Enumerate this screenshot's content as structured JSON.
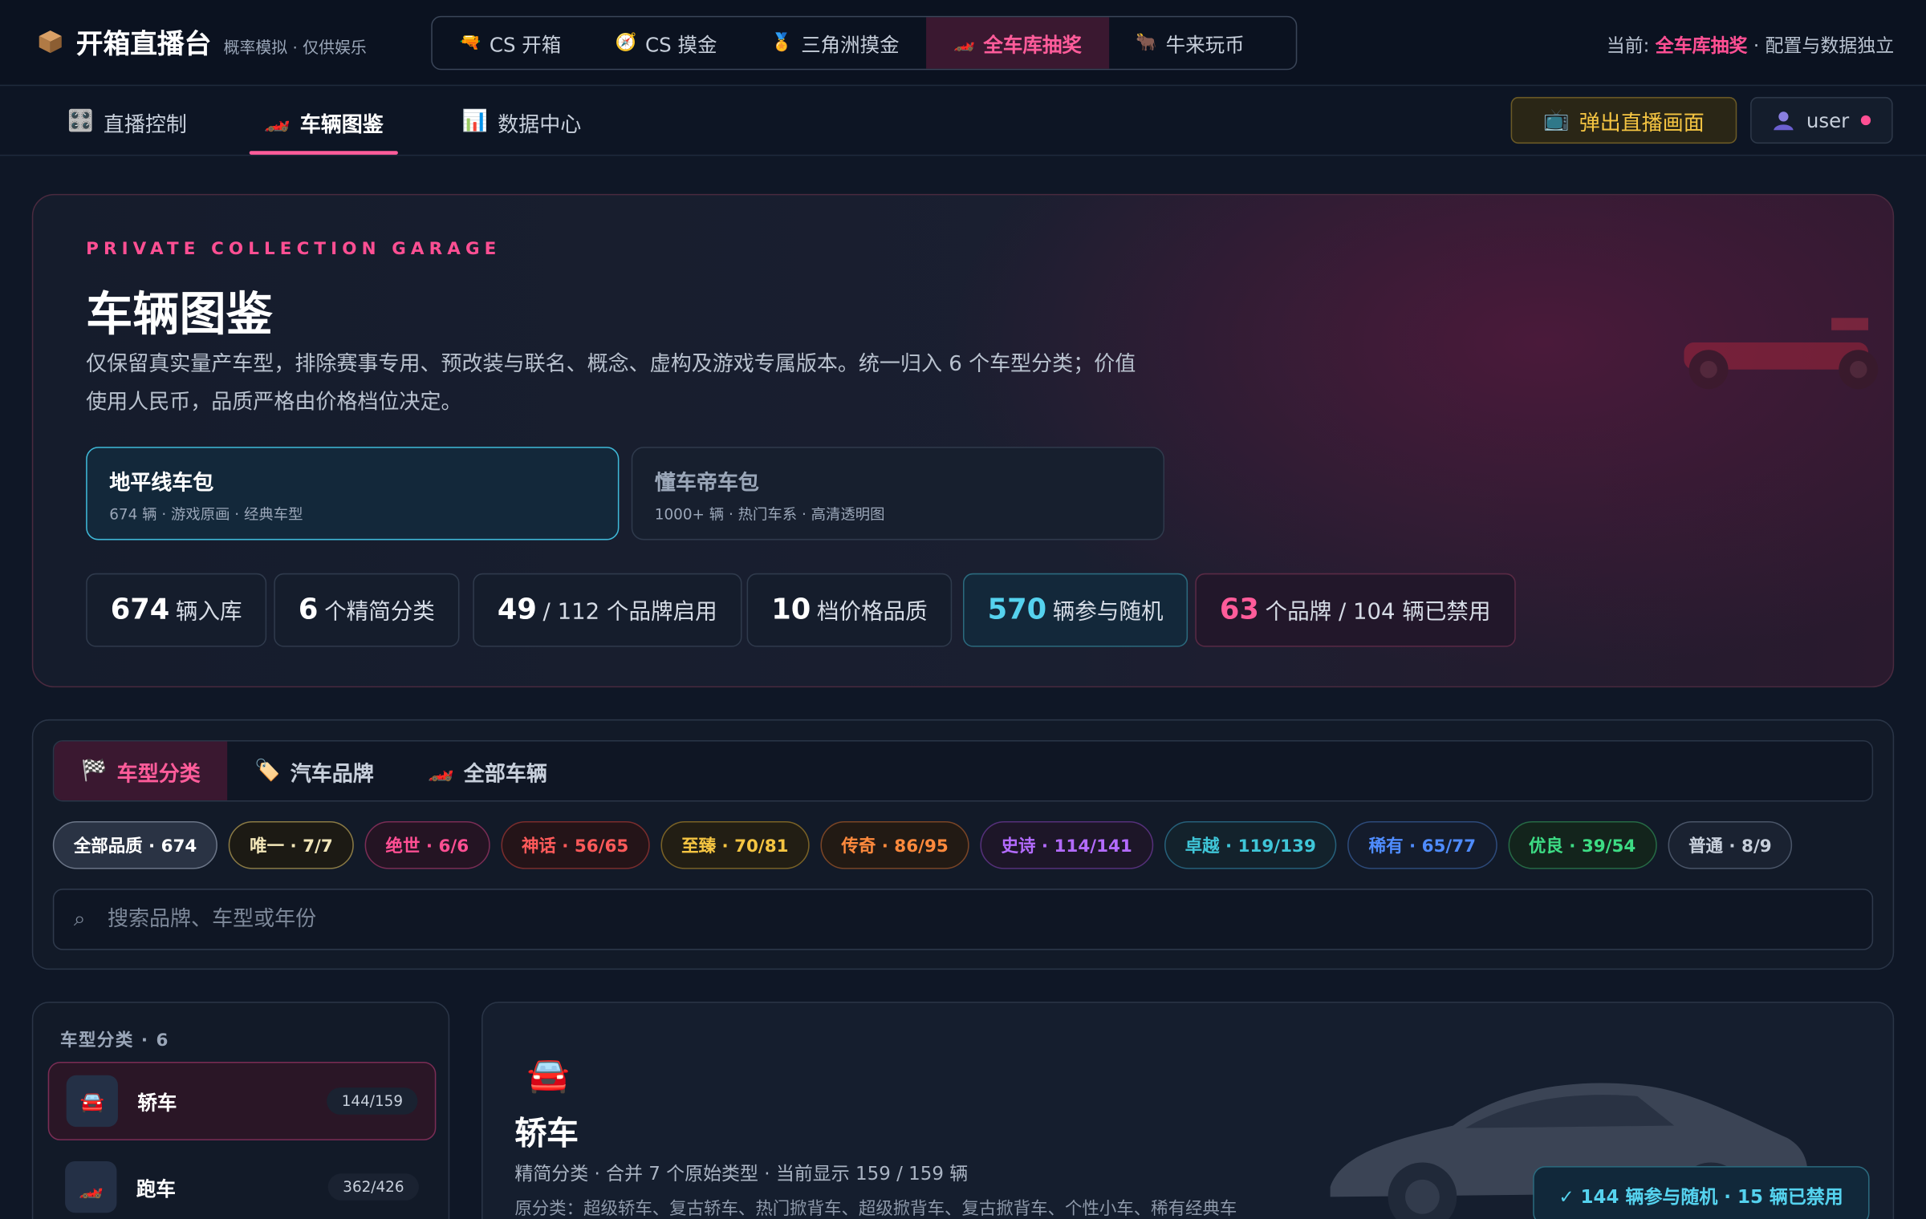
{
  "app": {
    "name": "开箱直播台",
    "subtitle": "概率模拟 · 仅供娱乐",
    "game_tabs": [
      {
        "label": "CS 开箱",
        "icon": "🔫"
      },
      {
        "label": "CS 摸金",
        "icon": "🧭"
      },
      {
        "label": "三角洲摸金",
        "icon": "🏅"
      },
      {
        "label": "全车库抽奖",
        "icon": "🏎️"
      },
      {
        "label": "牛来玩币",
        "icon": "🐂"
      }
    ],
    "active_game_tab": "全车库抽奖",
    "current_prefix": "当前:",
    "current_value": "全车库抽奖",
    "current_suffix": "· 配置与数据独立"
  },
  "subnav": {
    "tabs": [
      {
        "label": "直播控制",
        "icon": "🎛️"
      },
      {
        "label": "车辆图鉴",
        "icon": "🏎️"
      },
      {
        "label": "数据中心",
        "icon": "📊"
      }
    ],
    "active": "车辆图鉴",
    "popout_label": "弹出直播画面",
    "popout_icon": "📺",
    "user_label": "user"
  },
  "hero": {
    "kicker": "PRIVATE COLLECTION GARAGE",
    "title": "车辆图鉴",
    "description": "仅保留真实量产车型，排除赛事专用、预改装与联名、概念、虚构及游戏专属版本。统一归入 6 个车型分类；价值使用人民币，品质严格由价格档位决定。",
    "packs": [
      {
        "title": "地平线车包",
        "sub": "674 辆 · 游戏原画 · 经典车型",
        "selected": true
      },
      {
        "title": "懂车帝车包",
        "sub": "1000+ 辆 · 热门车系 · 高清透明图",
        "selected": false
      }
    ],
    "stats": [
      {
        "num": "674",
        "text": "辆入库"
      },
      {
        "num": "6",
        "text": "个精简分类"
      },
      {
        "num": "49",
        "text": "/ 112 个品牌启用"
      },
      {
        "num": "10",
        "text": "档价格品质"
      },
      {
        "num": "570",
        "text": "辆参与随机"
      },
      {
        "num": "63",
        "text": "个品牌 / 104 辆已禁用"
      }
    ]
  },
  "filter": {
    "tabs": [
      {
        "label": "车型分类",
        "icon": "🏁"
      },
      {
        "label": "汽车品牌",
        "icon": "🏷️"
      },
      {
        "label": "全部车辆",
        "icon": "🏎️"
      }
    ],
    "active_tab": "车型分类",
    "chips": [
      {
        "label": "全部品质 · 674",
        "color": "#ffffff",
        "border": "#6b7587",
        "bg": "#2a3344"
      },
      {
        "label": "唯一 · 7/7",
        "color": "#f2e6b8",
        "border": "#8a7a45",
        "bg": "#1c1a14"
      },
      {
        "label": "绝世 · 6/6",
        "color": "#ff4f93",
        "border": "#7a2d55",
        "bg": "#241423"
      },
      {
        "label": "神话 · 56/65",
        "color": "#ff5a5a",
        "border": "#7a2d2d",
        "bg": "#241418"
      },
      {
        "label": "至臻 · 70/81",
        "color": "#f5c542",
        "border": "#7a6226",
        "bg": "#221e14"
      },
      {
        "label": "传奇 · 86/95",
        "color": "#ff8a3d",
        "border": "#7a4526",
        "bg": "#221a14"
      },
      {
        "label": "史诗 · 114/141",
        "color": "#b36bff",
        "border": "#55307a",
        "bg": "#1d1628"
      },
      {
        "label": "卓越 · 119/139",
        "color": "#3fc6d8",
        "border": "#26607a",
        "bg": "#13222c"
      },
      {
        "label": "稀有 · 65/77",
        "color": "#4f8cff",
        "border": "#2d4a7a",
        "bg": "#141c2c"
      },
      {
        "label": "优良 · 39/54",
        "color": "#3ddc84",
        "border": "#266a45",
        "bg": "#13241c"
      },
      {
        "label": "普通 · 8/9",
        "color": "#c7cfdb",
        "border": "#4a5568",
        "bg": "#1a2231"
      }
    ],
    "search_placeholder": "搜索品牌、车型或年份",
    "search_icon": "⌕"
  },
  "side": {
    "header": "车型分类 · 6",
    "items": [
      {
        "name": "轿车",
        "count": "144/159",
        "icon": "🚘"
      },
      {
        "name": "跑车",
        "count": "362/426",
        "icon": "🏎️"
      }
    ]
  },
  "detail": {
    "icon": "🚘",
    "title": "轿车",
    "line1": "精简分类 · 合并 7 个原始类型 · 当前显示 159 / 159 辆",
    "line2": "原分类：超级轿车、复古轿车、热门掀背车、超级掀背车、复古掀背车、个性小车、稀有经典车",
    "badge": "✓ 144 辆参与随机 · 15 辆已禁用"
  }
}
